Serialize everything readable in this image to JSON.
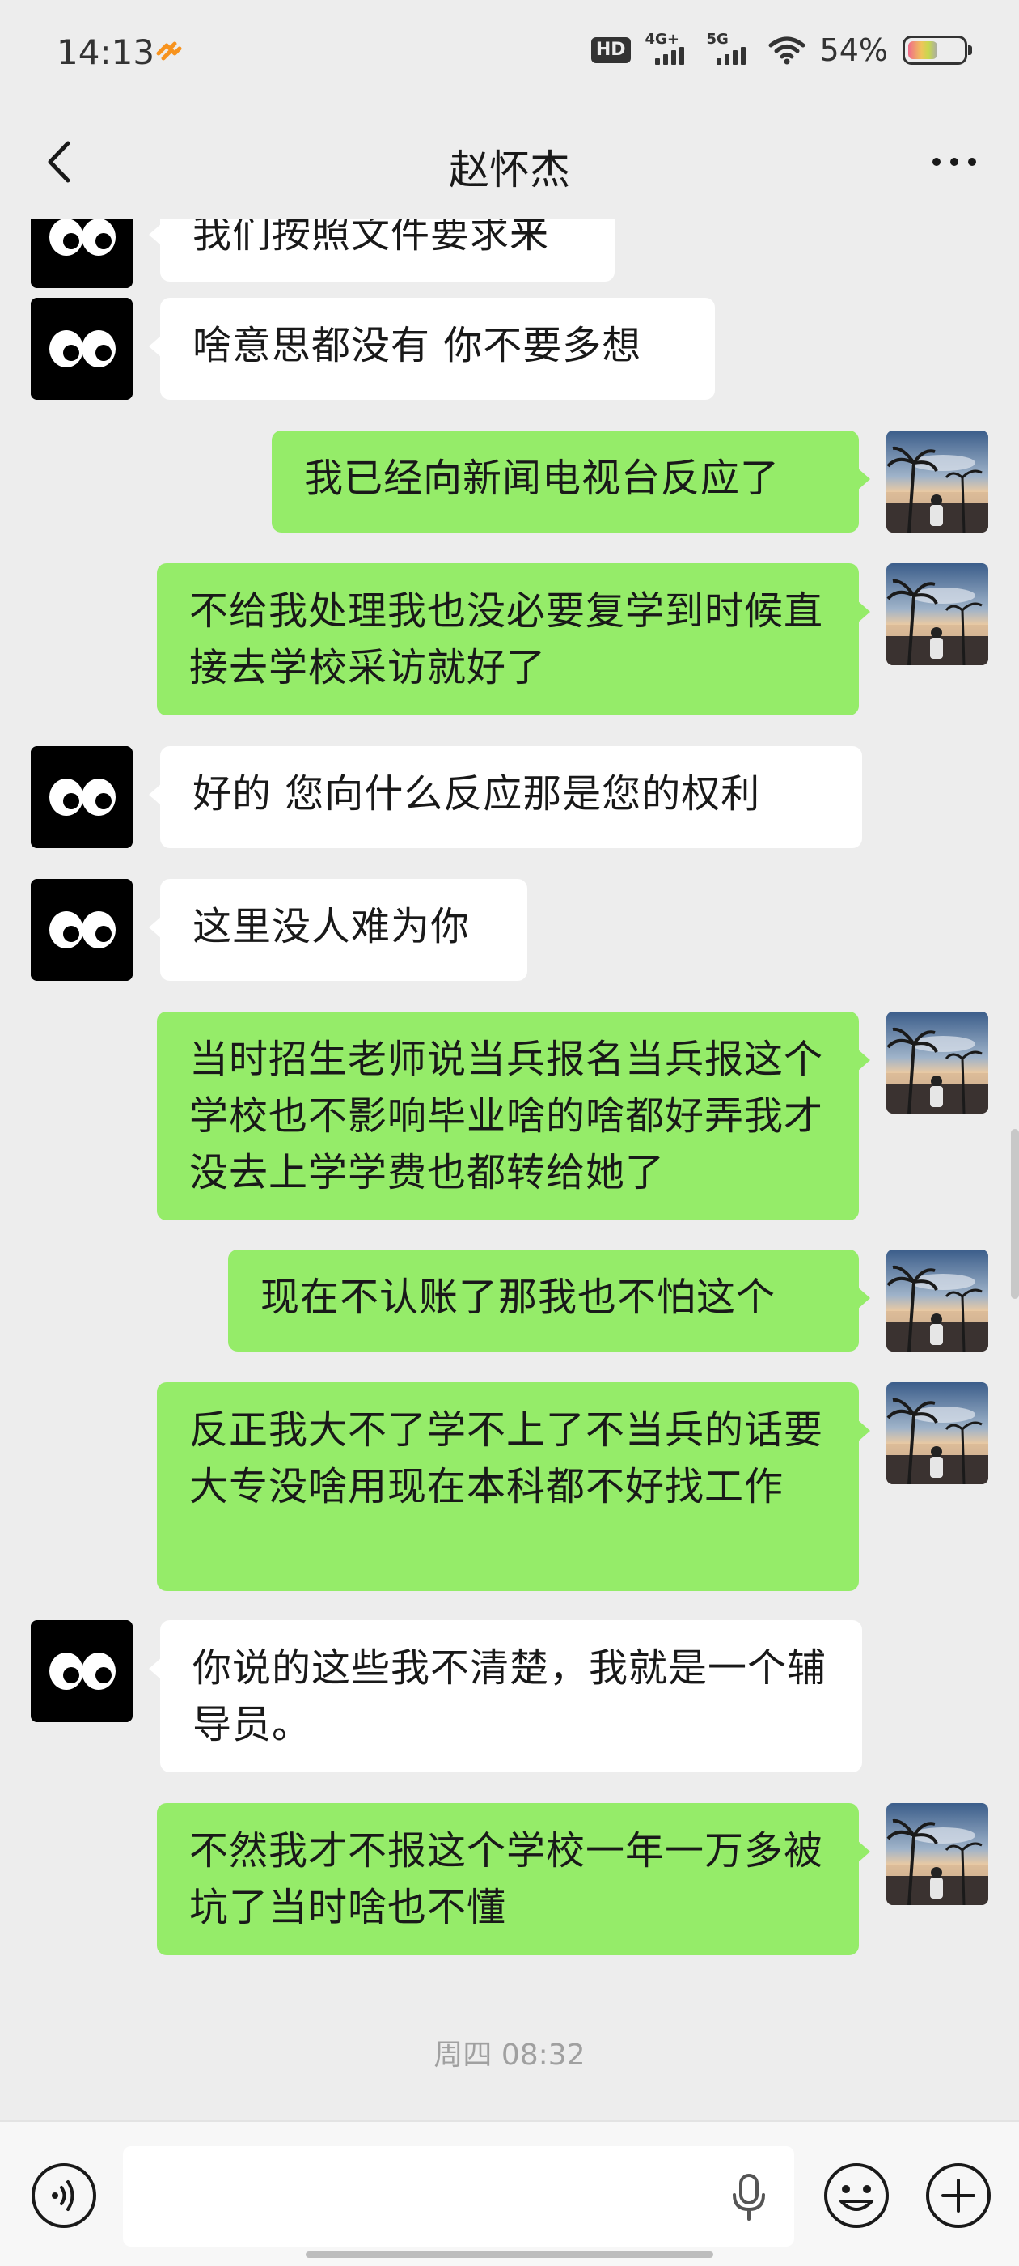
{
  "status_bar": {
    "time": "14:13",
    "hd_label": "HD",
    "network_1": "4G+",
    "network_2": "5G",
    "battery_percent": "54%",
    "battery_level": 0.54
  },
  "header": {
    "title": "赵怀杰",
    "back_icon": "chevron-left-icon",
    "more_icon": "more-horizontal-icon"
  },
  "messages": [
    {
      "from": "contact",
      "text": "我们按照文件要求来"
    },
    {
      "from": "contact",
      "text": "啥意思都没有 你不要多想"
    },
    {
      "from": "me",
      "text": "我已经向新闻电视台反应了"
    },
    {
      "from": "me",
      "text": "不给我处理我也没必要复学到时候直接去学校采访就好了"
    },
    {
      "from": "contact",
      "text": "好的 您向什么反应那是您的权利"
    },
    {
      "from": "contact",
      "text": "这里没人难为你"
    },
    {
      "from": "me",
      "text": "当时招生老师说当兵报名当兵报这个学校也不影响毕业啥的啥都好弄我才没去上学学费也都转给她了"
    },
    {
      "from": "me",
      "text": "现在不认账了那我也不怕这个"
    },
    {
      "from": "me",
      "text": "反正我大不了学不上了不当兵的话要大专没啥用现在本科都不好找工作"
    },
    {
      "from": "contact",
      "text": "你说的这些我不清楚，我就是一个辅导员。"
    },
    {
      "from": "me",
      "text": "不然我才不报这个学校一年一万多被坑了当时啥也不懂"
    }
  ],
  "timestamp": "周四 08:32",
  "input_bar": {
    "voice_icon": "voice-icon",
    "placeholder": "",
    "mic_icon": "mic-icon",
    "emoji_icon": "emoji-icon",
    "plus_icon": "plus-icon"
  },
  "colors": {
    "background": "#ededed",
    "bubble_out": "#95ec69",
    "bubble_in": "#ffffff",
    "contact_avatar": "#000000"
  }
}
